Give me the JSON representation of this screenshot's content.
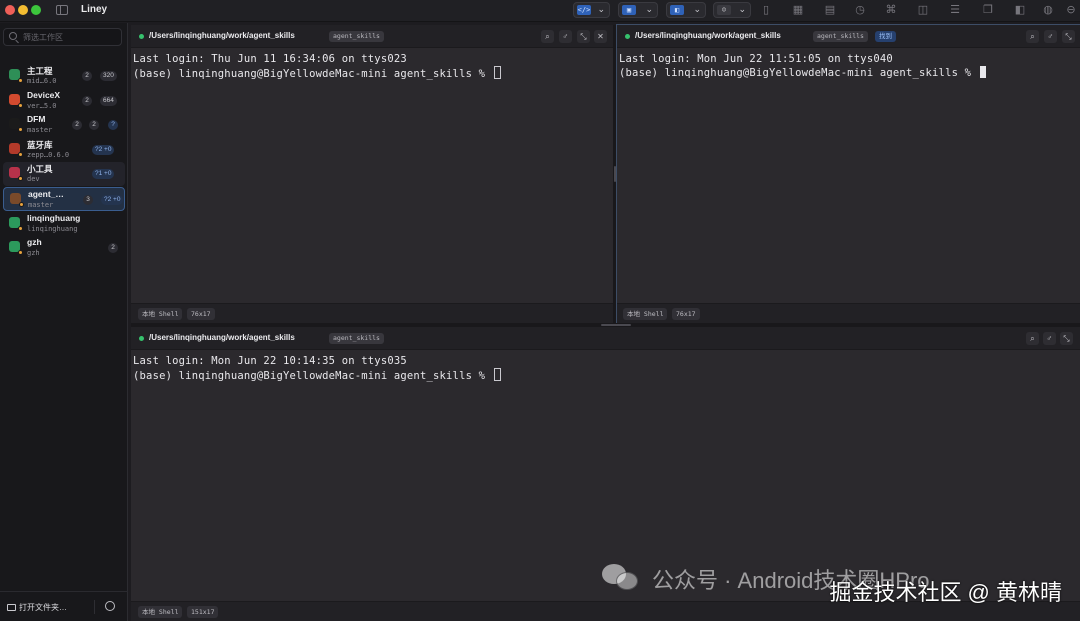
{
  "app": {
    "title": "Liney"
  },
  "toolbar": {
    "segments": [
      {
        "icon": "code-icon",
        "glyph": "</>"
      },
      {
        "icon": "window-icon",
        "glyph": "▣"
      },
      {
        "icon": "app-icon",
        "glyph": "◧"
      },
      {
        "icon": "avatar-icon",
        "glyph": "☺"
      }
    ]
  },
  "sidebar": {
    "search_placeholder": "筛选工作区",
    "workspaces": [
      {
        "name": "主工程",
        "branch": "mid…6.0",
        "badges": [
          "2",
          "320"
        ],
        "color": "#2e8f57",
        "state": ""
      },
      {
        "name": "DeviceX",
        "branch": "ver…5.0",
        "badges": [
          "2",
          "664"
        ],
        "color": "#d24a2f",
        "state": ""
      },
      {
        "name": "DFM",
        "branch": "master",
        "badges": [
          "2",
          "2",
          "?"
        ],
        "color": "#1b1b1b",
        "state": ""
      },
      {
        "name": "蓝牙库",
        "branch": "zepp…0.6.0",
        "badges": [
          "?2 +0"
        ],
        "color": "#b33a2a",
        "state": ""
      },
      {
        "name": "小工具",
        "branch": "dev",
        "badges": [
          "?1 +0"
        ],
        "color": "#b8324a",
        "state": "hover"
      },
      {
        "name": "agent_…",
        "branch": "master",
        "badges": [
          "3",
          "?2 +0"
        ],
        "color": "#7a4a2a",
        "state": "active"
      },
      {
        "name": "linqinghuang",
        "branch": "linqinghuang",
        "badges": [],
        "color": "#2c9a5c",
        "state": ""
      },
      {
        "name": "gzh",
        "branch": "gzh",
        "badges": [
          "2"
        ],
        "color": "#2c9a5c",
        "state": ""
      }
    ],
    "open_folder": "打开文件夹…"
  },
  "panes": [
    {
      "path": "/Users/linqinghuang/work/agent_skills",
      "tag": "agent_skills",
      "extra_tag": "",
      "lines": [
        "Last login: Thu Jun 11 16:34:06 on ttys023",
        "(base) linqinghuang@BigYellowdeMac-mini agent_skills % "
      ],
      "shell": "本地 Shell",
      "size": "76x17"
    },
    {
      "path": "/Users/linqinghuang/work/agent_skills",
      "tag": "agent_skills",
      "extra_tag": "找到",
      "lines": [
        "Last login: Mon Jun 22 11:51:05 on ttys040",
        "(base) linqinghuang@BigYellowdeMac-mini agent_skills % "
      ],
      "shell": "本地 Shell",
      "size": "76x17"
    },
    {
      "path": "/Users/linqinghuang/work/agent_skills",
      "tag": "agent_skills",
      "extra_tag": "",
      "lines": [
        "Last login: Mon Jun 22 10:14:35 on ttys035",
        "(base) linqinghuang@BigYellowdeMac-mini agent_skills % "
      ],
      "shell": "本地 Shell",
      "size": "151x17"
    }
  ],
  "watermark": {
    "wechat": "公众号 · Android技术圈HPro",
    "juejin": "掘金技术社区 @ 黄林晴"
  }
}
